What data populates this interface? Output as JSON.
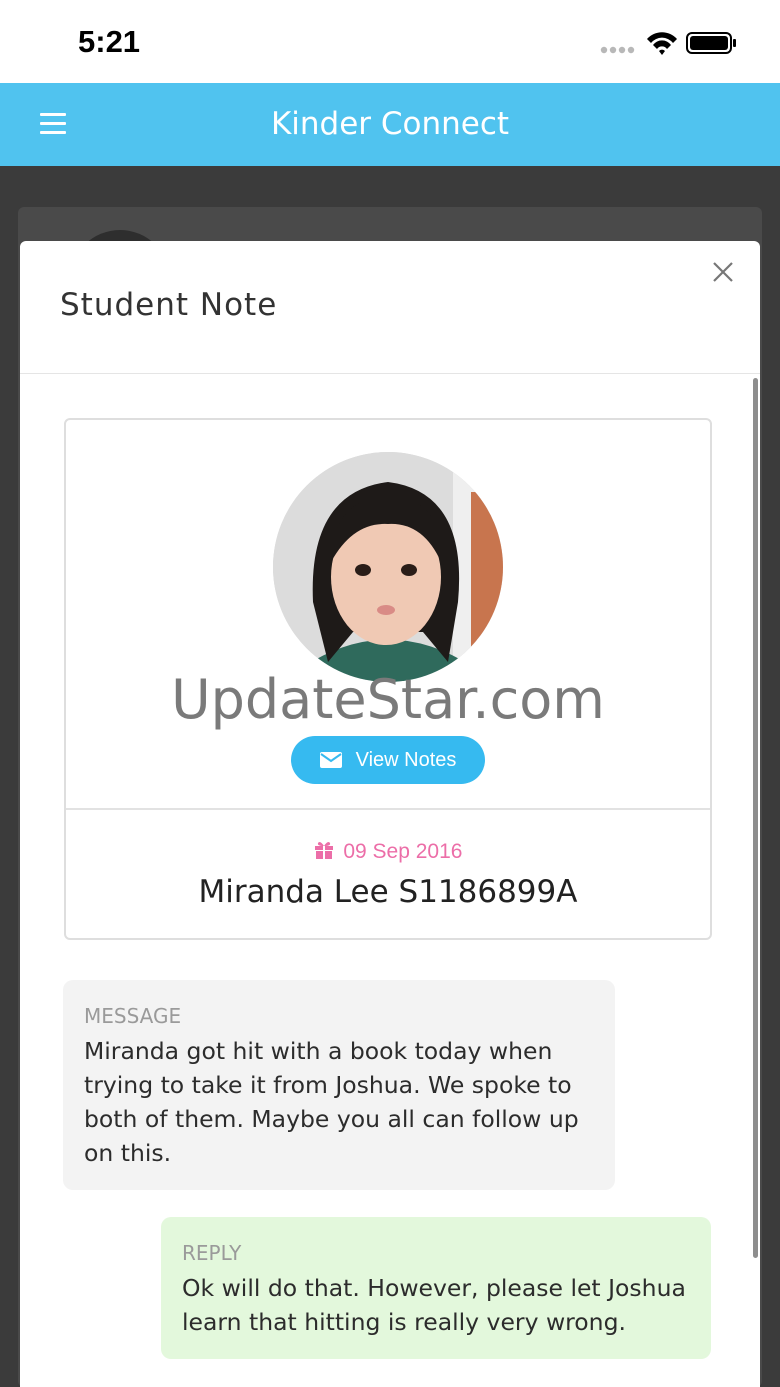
{
  "status_bar": {
    "time": "5:21",
    "icons": [
      "signal-dots-icon",
      "wifi-icon",
      "battery-icon"
    ]
  },
  "header": {
    "title": "Kinder Connect",
    "menu_icon": "hamburger-menu-icon",
    "background": "#50c3ef"
  },
  "modal": {
    "title": "Student Note",
    "close_icon": "close-icon"
  },
  "student": {
    "watermark": "UpdateStar.com",
    "view_notes_label": "View Notes",
    "birthday": "09 Sep 2016",
    "name": "Miranda Lee S1186899A"
  },
  "message": {
    "label": "MESSAGE",
    "text": "Miranda got hit with a book today when trying to take it from Joshua. We spoke to both of them. Maybe you all can follow up on this."
  },
  "reply": {
    "label": "REPLY",
    "text": "Ok will do that. However, please let Joshua learn that hitting is really very wrong."
  },
  "colors": {
    "accent": "#36baf0",
    "birthday": "#ec6ea8",
    "reply_bg": "#e3f8dc",
    "message_bg": "#f3f3f3"
  }
}
